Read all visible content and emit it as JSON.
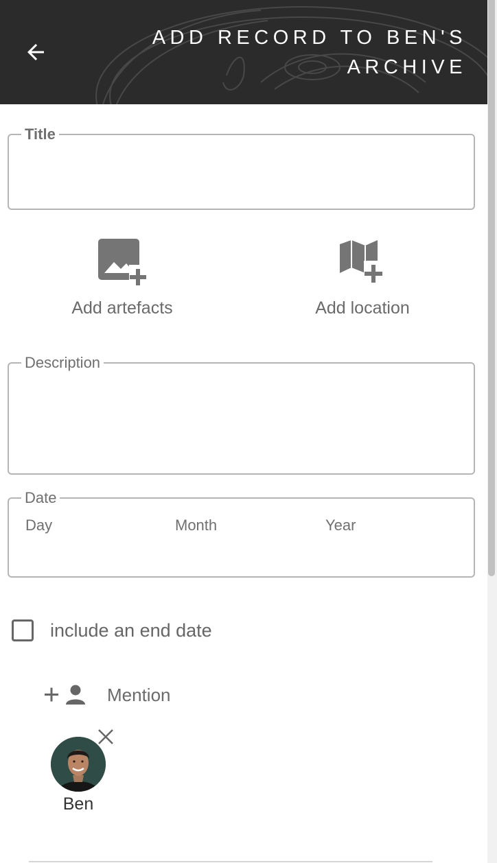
{
  "header": {
    "title": "ADD RECORD TO BEN'S ARCHIVE",
    "back_icon": "arrow-left-icon",
    "background": "#2b2b2b"
  },
  "form": {
    "title_field": {
      "label": "Title",
      "value": ""
    },
    "description_field": {
      "label": "Description",
      "value": ""
    },
    "date_field": {
      "label": "Date",
      "day_placeholder": "Day",
      "month_placeholder": "Month",
      "year_placeholder": "Year"
    },
    "end_date_checkbox": {
      "label": "include an end date",
      "checked": false
    }
  },
  "actions": {
    "add_artefacts": {
      "label": "Add artefacts",
      "icon": "add-image-icon"
    },
    "add_location": {
      "label": "Add location",
      "icon": "add-map-icon"
    }
  },
  "mention": {
    "label": "Mention",
    "icon": "add-person-icon"
  },
  "mentioned_people": [
    {
      "name": "Ben"
    }
  ],
  "colors": {
    "icon_gray": "#757575",
    "border_gray": "#b5b5b5"
  }
}
